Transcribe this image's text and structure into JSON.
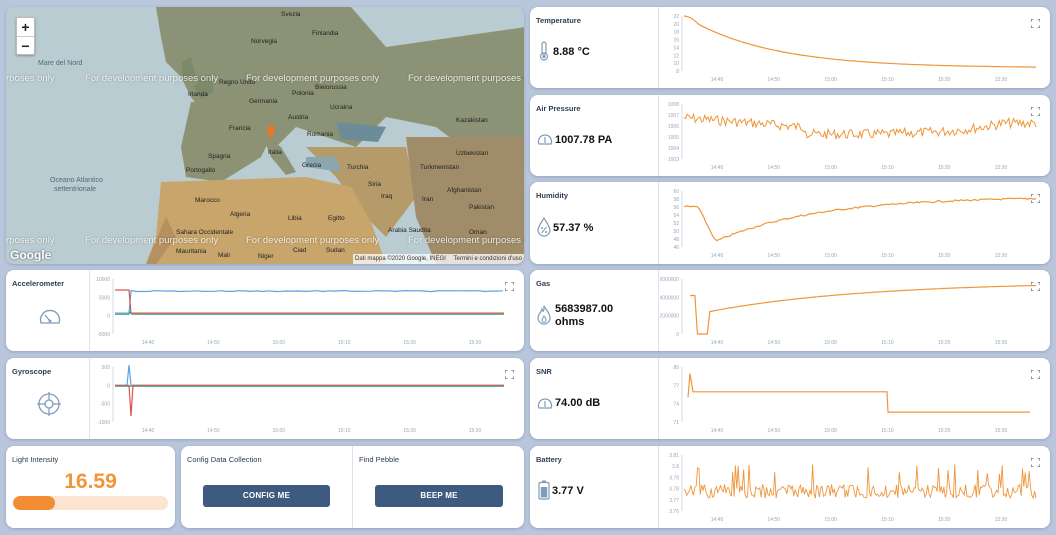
{
  "map": {
    "zoom_in": "+",
    "zoom_out": "−",
    "dev_watermark": "For development purposes only",
    "dev_watermark_partial": "rposes only",
    "attribution": "Dati mappa ©2020 Google, INEGI",
    "terms": "Termini e condizioni d'uso",
    "google_logo": "Google",
    "labels": {
      "svezia": "Svezia",
      "finlandia": "Finlandia",
      "norvegia": "Norvegia",
      "regno_unito": "Regno Unito",
      "irlanda": "Irlanda",
      "bielorussia": "Bielorussia",
      "germania": "Germania",
      "polonia": "Polonia",
      "ucraina": "Ucraina",
      "francia": "Francia",
      "austria": "Austria",
      "romania": "Romania",
      "italia": "Italia",
      "kazakistan": "Kazakistan",
      "uzbekistan": "Uzbekistan",
      "spagna": "Spagna",
      "portogallo": "Portogallo",
      "grecia": "Grecia",
      "turchia": "Turchia",
      "turkmenistan": "Turkmenistan",
      "siria": "Siria",
      "iraq": "Iraq",
      "iran": "Iran",
      "afghanistan": "Afghanistan",
      "marocco": "Marocco",
      "algeria": "Algeria",
      "libia": "Libia",
      "egitto": "Egitto",
      "pakistan": "Pakistan",
      "sahara_occ": "Sahara Occidentale",
      "mauritania": "Mauritania",
      "mali": "Mali",
      "niger": "Niger",
      "ciad": "Ciad",
      "sudan": "Sudan",
      "arabia": "Arabia Saudita",
      "oman": "Oman",
      "mare_nord": "Mare del Nord",
      "oceano_1": "Oceano Atlantico",
      "oceano_2": "settentrionale"
    }
  },
  "sensors": {
    "temperature": {
      "label": "Temperature",
      "value": "8.88 °C",
      "icon": "thermometer-icon",
      "yticks": [
        "22",
        "20",
        "18",
        "16",
        "14",
        "12",
        "10",
        "8"
      ],
      "xticks": [
        "14:40",
        "14:50",
        "15:00",
        "15:10",
        "15:20",
        "15:30"
      ]
    },
    "air_pressure": {
      "label": "Air Pressure",
      "value": "1007.78 PA",
      "icon": "barometer-icon",
      "yticks": [
        "1008",
        "1007",
        "1006",
        "1005",
        "1004",
        "1003"
      ],
      "xticks": [
        "14:40",
        "14:50",
        "15:00",
        "15:10",
        "15:20",
        "15:30"
      ]
    },
    "humidity": {
      "label": "Humidity",
      "value": "57.37 %",
      "icon": "humidity-drop-icon",
      "yticks": [
        "60",
        "58",
        "56",
        "54",
        "52",
        "50",
        "48",
        "46"
      ],
      "xticks": [
        "14:40",
        "14:50",
        "15:00",
        "15:10",
        "15:20",
        "15:30"
      ]
    },
    "accelerometer": {
      "label": "Accelerometer",
      "icon": "speedometer-icon",
      "yticks": [
        "10000",
        "5000",
        "0",
        "-5000"
      ],
      "xticks": [
        "14:40",
        "14:50",
        "15:00",
        "15:10",
        "15:20",
        "15:30"
      ]
    },
    "gyroscope": {
      "label": "Gyroscope",
      "icon": "gyroscope-icon",
      "yticks": [
        "500",
        "0",
        "-500",
        "-1000"
      ],
      "xticks": [
        "14:40",
        "14:50",
        "15:00",
        "15:10",
        "15:20",
        "15:30"
      ]
    },
    "gas": {
      "label": "Gas",
      "value_line1": "5683987.00",
      "value_line2": "ohms",
      "icon": "flame-icon",
      "yticks": [
        "6000000",
        "4000000",
        "2000000",
        "0"
      ],
      "xticks": [
        "14:40",
        "14:50",
        "15:00",
        "15:10",
        "15:20",
        "15:30"
      ]
    },
    "snr": {
      "label": "SNR",
      "value": "74.00 dB",
      "icon": "signal-gauge-icon",
      "yticks": [
        "80",
        "77",
        "74",
        "71"
      ],
      "xticks": [
        "14:40",
        "14:50",
        "15:00",
        "15:10",
        "15:20",
        "15:30"
      ]
    },
    "battery": {
      "label": "Battery",
      "value": "3.77 V",
      "icon": "battery-icon",
      "yticks": [
        "3.81",
        "3.8",
        "3.79",
        "3.78",
        "3.77",
        "3.76"
      ],
      "xticks": [
        "14:40",
        "14:50",
        "15:00",
        "15:10",
        "15:20",
        "15:30"
      ]
    }
  },
  "light": {
    "label": "Light Intensity",
    "value": "16.59",
    "progress": 0.27
  },
  "config": {
    "label": "Config Data Collection",
    "button": "CONFIG ME"
  },
  "pebble": {
    "label": "Find Pebble",
    "button": "BEEP ME"
  },
  "colors": {
    "accent": "#f0953a",
    "button": "#3e5a7e",
    "line_blue": "#5aa3e6",
    "line_red": "#d9534f",
    "line_green": "#2e9e6a"
  }
}
